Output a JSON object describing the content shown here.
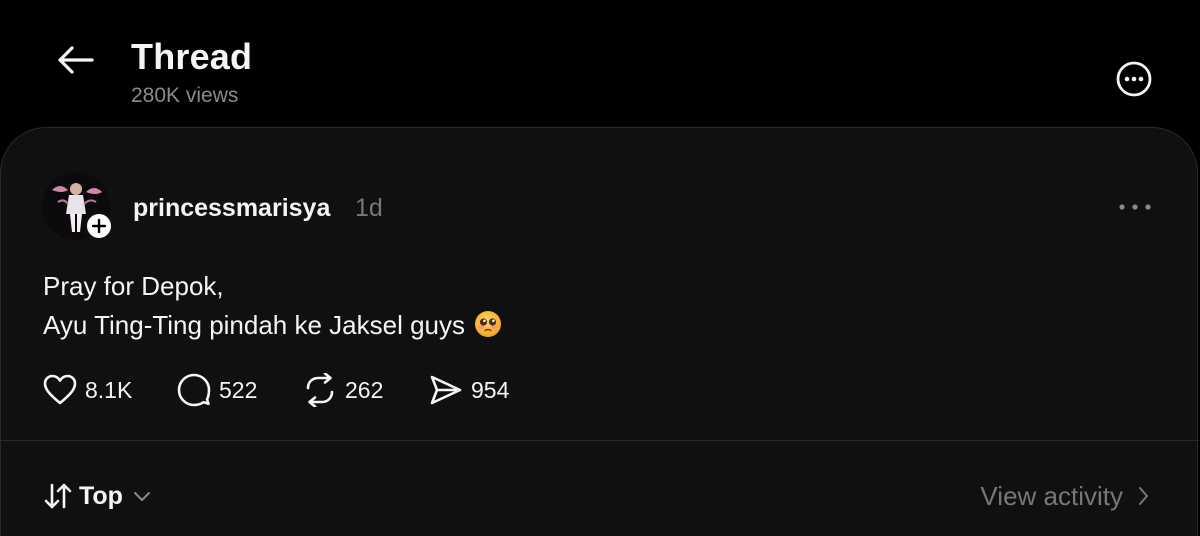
{
  "header": {
    "title": "Thread",
    "views": "280K views",
    "back_icon": "arrow-left-icon",
    "more_icon": "more-circle-icon"
  },
  "post": {
    "username": "princessmarisya",
    "time": "1d",
    "text_lines": [
      "Pray for Depok,",
      "Ayu Ting-Ting pindah ke Jaksel guys"
    ],
    "emoji": "pleading-face-emoji",
    "actions": {
      "likes": "8.1K",
      "comments": "522",
      "reposts": "262",
      "shares": "954"
    }
  },
  "footer": {
    "sort_label": "Top",
    "activity_label": "View activity"
  },
  "colors": {
    "background": "#000000",
    "card": "#101010",
    "primary_text": "#f3f5f7",
    "secondary_text": "#777777"
  }
}
